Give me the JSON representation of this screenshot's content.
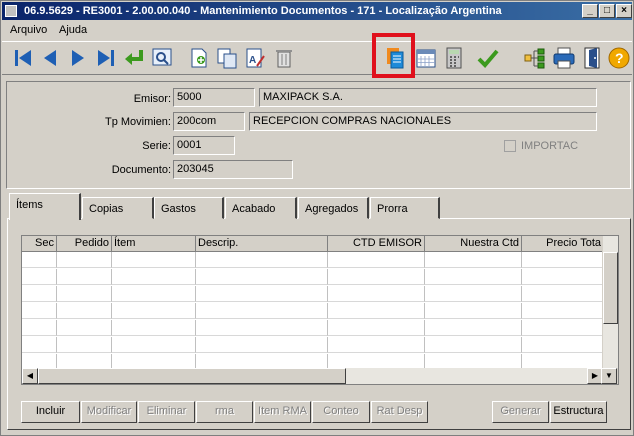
{
  "window": {
    "title": "06.9.5629 - RE3001 - 2.00.00.040 - Mantenimiento Documentos - 171 - Localização Argentina",
    "minimize": "_",
    "maximize": "□",
    "close": "×"
  },
  "menu": [
    "Arquivo",
    "Ajuda"
  ],
  "toolbar": {
    "icons": [
      "first-icon",
      "previous-icon",
      "next-icon",
      "last-icon",
      "goto-icon",
      "search-icon",
      "new-document-icon",
      "copy-icon",
      "edit-icon",
      "delete-icon",
      "documents-icon",
      "calendar-icon",
      "calculator-icon",
      "check-icon",
      "tree-icon",
      "print-icon",
      "exit-icon",
      "help-icon"
    ],
    "help_glyph": "?"
  },
  "form": {
    "emisor": {
      "label": "Emisor:",
      "code": "5000",
      "name": "MAXIPACK S.A."
    },
    "tp_movimien": {
      "label": "Tp Movimien:",
      "code": "200com",
      "name": "RECEPCION COMPRAS NACIONALES"
    },
    "serie": {
      "label": "Serie:",
      "value": "0001"
    },
    "documento": {
      "label": "Documento:",
      "value": "203045"
    },
    "importac": {
      "label": "IMPORTAC",
      "checked": false
    }
  },
  "tabs": [
    "Ítems",
    "Copias",
    "Gastos",
    "Acabado",
    "Agregados",
    "Prorra"
  ],
  "active_tab": "Ítems",
  "grid": {
    "columns": [
      "Sec",
      "Pedido",
      "Ítem",
      "Descrip.",
      "CTD EMISOR",
      "Nuestra Ctd",
      "Precio Tota"
    ],
    "rows": []
  },
  "actions": [
    {
      "label": "Incluir",
      "enabled": true
    },
    {
      "label": "Modificar",
      "enabled": false
    },
    {
      "label": "Eliminar",
      "enabled": false
    },
    {
      "label": "rma",
      "enabled": false
    },
    {
      "label": "Item RMA",
      "enabled": false
    },
    {
      "label": "Conteo",
      "enabled": false
    },
    {
      "label": "Rat Desp",
      "enabled": false
    },
    {
      "label": "Generar",
      "enabled": false
    },
    {
      "label": "Estructura",
      "enabled": true
    }
  ],
  "colors": {
    "highlight": "#e0101c",
    "title_bar": "#0a246a",
    "window_bg": "#d4d0c8"
  }
}
